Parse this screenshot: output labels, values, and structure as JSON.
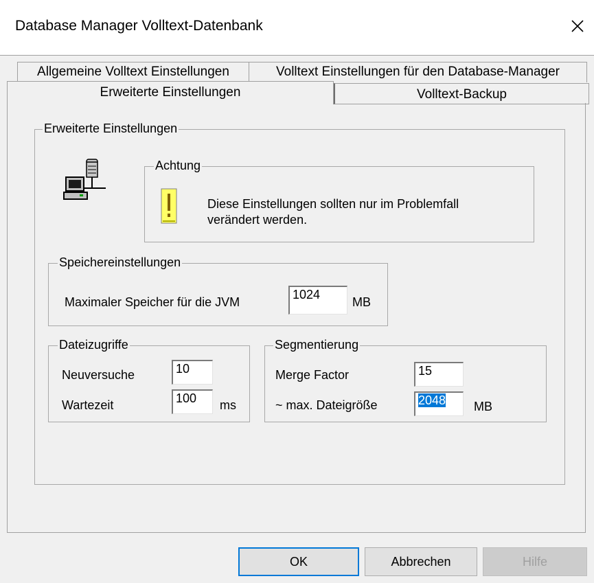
{
  "window": {
    "title": "Database Manager Volltext-Datenbank"
  },
  "icons": {
    "close": "close-icon",
    "computer": "computer-network-icon",
    "warning": "exclamation-icon"
  },
  "tabs": [
    {
      "label": "Allgemeine Volltext Einstellungen"
    },
    {
      "label": "Volltext Einstellungen für den Database-Manager"
    },
    {
      "label": "Erweiterte Einstellungen",
      "selected": true
    },
    {
      "label": "Volltext-Backup"
    }
  ],
  "main_group": {
    "label": "Erweiterte Einstellungen"
  },
  "warning": {
    "label": "Achtung",
    "line1": "Diese Einstellungen sollten nur im Problemfall",
    "line2": "verändert werden."
  },
  "memory": {
    "label": "Speichereinstellungen",
    "field_label": "Maximaler Speicher für die JVM",
    "value": "1024",
    "unit": "MB"
  },
  "file_access": {
    "label": "Dateizugriffe",
    "retries_label": "Neuversuche",
    "retries_value": "10",
    "wait_label": "Wartezeit",
    "wait_value": "100",
    "wait_unit": "ms"
  },
  "segmentation": {
    "label": "Segmentierung",
    "merge_label": "Merge Factor",
    "merge_value": "15",
    "maxsize_label": "~ max. Dateigröße",
    "maxsize_value": "2048",
    "maxsize_unit": "MB"
  },
  "buttons": {
    "ok": "OK",
    "cancel": "Abbrechen",
    "help": "Hilfe"
  },
  "colors": {
    "selection": "#0078d7",
    "warning_icon": "#ffff66"
  }
}
